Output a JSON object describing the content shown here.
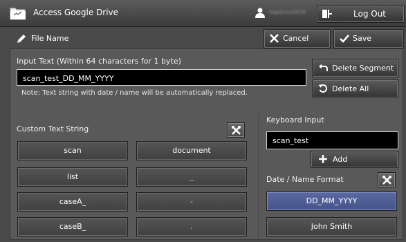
{
  "topbar": {
    "title": "Access Google Drive",
    "user_name": "hapkuro2018",
    "logout_label": "Log Out"
  },
  "header": {
    "title": "File Name",
    "cancel_label": "Cancel",
    "save_label": "Save"
  },
  "input": {
    "label": "Input Text (Within 64 characters for 1 byte)",
    "value": "scan_test_DD_MM_YYYY",
    "note": "Note: Text string with date / name will be automatically replaced."
  },
  "actions": {
    "delete_segment": "Delete Segment",
    "delete_all": "Delete All"
  },
  "custom": {
    "label": "Custom Text String",
    "buttons": [
      "scan",
      "document",
      "list",
      "_",
      "caseA_",
      "-",
      "caseB_",
      "."
    ]
  },
  "keyboard": {
    "label": "Keyboard Input",
    "value": "scan_test",
    "add_label": "Add"
  },
  "format": {
    "label": "Date / Name Format",
    "options": [
      "DD_MM_YYYY",
      "John Smith"
    ],
    "selected": "DD_MM_YYYY"
  },
  "colors": {
    "background": "#4a4a4a",
    "panel": "#595959",
    "selected_format": "#4f5f98",
    "input_background": "#000000"
  }
}
